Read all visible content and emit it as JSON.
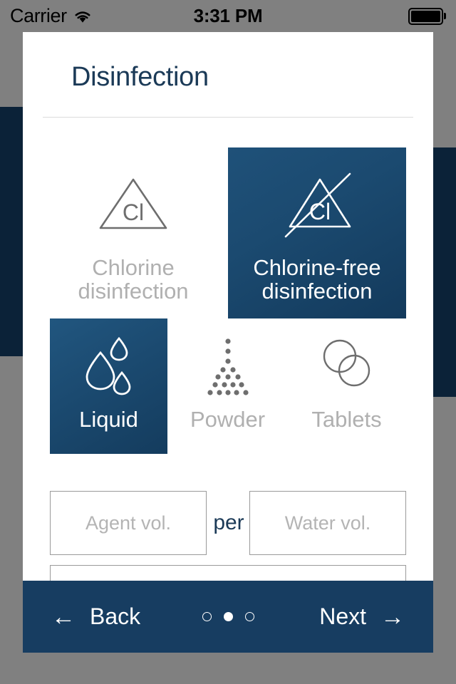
{
  "status_bar": {
    "carrier": "Carrier",
    "wifi_icon": "wifi-icon",
    "time": "3:31 PM",
    "battery_icon": "battery-full-icon"
  },
  "card": {
    "title": "Disinfection",
    "method_tiles": [
      {
        "id": "chlorine",
        "label_line1": "Chlorine",
        "label_line2": "disinfection",
        "icon": "chlorine-triangle-icon",
        "selected": false
      },
      {
        "id": "chlorine-free",
        "label_line1": "Chlorine-free",
        "label_line2": "disinfection",
        "icon": "chlorine-free-triangle-crossed-icon",
        "selected": true
      }
    ],
    "form_tiles": [
      {
        "id": "liquid",
        "label": "Liquid",
        "icon": "water-droplets-icon",
        "selected": true
      },
      {
        "id": "powder",
        "label": "Powder",
        "icon": "powder-dots-icon",
        "selected": false
      },
      {
        "id": "tablets",
        "label": "Tablets",
        "icon": "tablets-circles-icon",
        "selected": false
      }
    ],
    "inputs": {
      "agent_volume": {
        "value": "",
        "placeholder": "Agent vol."
      },
      "per_label": "per",
      "water_volume": {
        "value": "",
        "placeholder": "Water vol."
      },
      "third_field": {
        "value": "",
        "placeholder": ""
      }
    }
  },
  "bottom_bar": {
    "back_label": "Back",
    "back_arrow": "←",
    "next_label": "Next",
    "next_arrow": "→",
    "pager": {
      "total": 3,
      "current": 2
    }
  },
  "colors": {
    "accent_navy": "#173d61",
    "title_navy": "#1b3a57",
    "selected_tile": "#1b4a70",
    "backdrop_navy": "#0b2238",
    "muted_text": "#b0b0b0",
    "screen_background": "#808080"
  }
}
